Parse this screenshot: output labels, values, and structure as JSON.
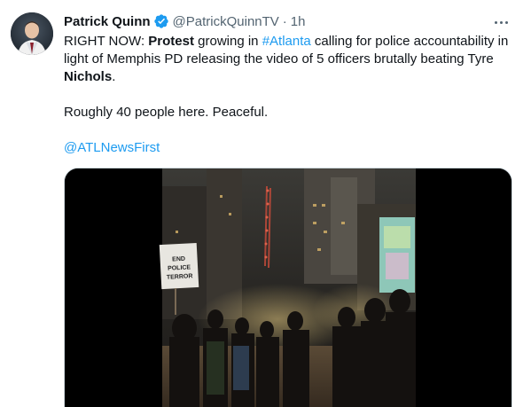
{
  "tweet": {
    "author_name": "Patrick Quinn",
    "handle": "@PatrickQuinnTV",
    "separator": "·",
    "time": "1h",
    "verified": true,
    "line1_a": "RIGHT NOW: ",
    "line1_b": "Protest",
    "line1_c": " growing in ",
    "line1_hashtag": "#Atlanta",
    "line1_d": " calling for police accountability in light of Memphis PD releasing the video of 5 officers brutally beating Tyre ",
    "line1_e": "Nichols",
    "line1_f": ".",
    "paragraph2": "Roughly 40 people here. Peaceful.",
    "mention": "@ATLNewsFirst"
  },
  "media": {
    "sign_text": "END POLICE TERROR",
    "type": "video"
  },
  "icons": {
    "verified": "verified-badge-icon",
    "more": "more-options-icon"
  },
  "colors": {
    "link": "#1d9bf0",
    "muted": "#536471",
    "text": "#0f1419",
    "media_bg": "#000000"
  }
}
